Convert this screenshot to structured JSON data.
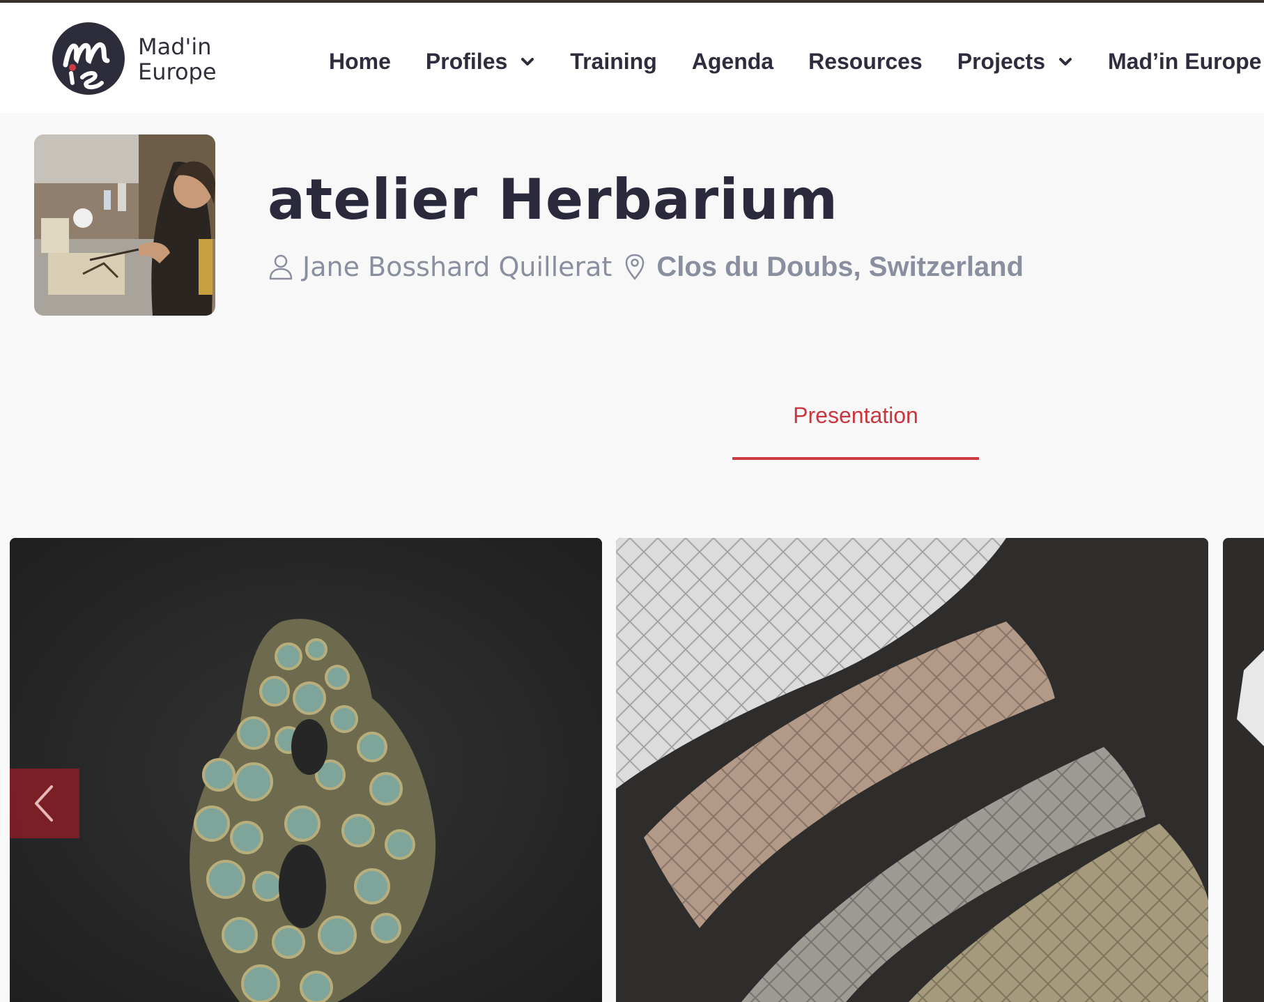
{
  "header": {
    "logo_text_line1": "Mad'in",
    "logo_text_line2": "Europe",
    "logo_monogram": "mie",
    "nav": [
      {
        "label": "Home",
        "has_dropdown": false
      },
      {
        "label": "Profiles",
        "has_dropdown": true
      },
      {
        "label": "Training",
        "has_dropdown": false
      },
      {
        "label": "Agenda",
        "has_dropdown": false
      },
      {
        "label": "Resources",
        "has_dropdown": false
      },
      {
        "label": "Projects",
        "has_dropdown": true
      },
      {
        "label": "Mad’in Europe",
        "has_dropdown": true
      }
    ]
  },
  "profile": {
    "title": "atelier Herbarium",
    "author": "Jane Bosshard Quillerat",
    "location": "Clos du Doubs, Switzerland"
  },
  "tabs": {
    "active_label": "Presentation"
  },
  "icons": {
    "author": "user-icon",
    "location": "map-pin-icon",
    "prev": "chevron-left-icon",
    "dropdown": "chevron-down-icon"
  },
  "colors": {
    "accent": "#cf3b43",
    "nav_text": "#2d2d3d",
    "meta_text": "#8a8fa0",
    "prev_button": "#821e26"
  }
}
